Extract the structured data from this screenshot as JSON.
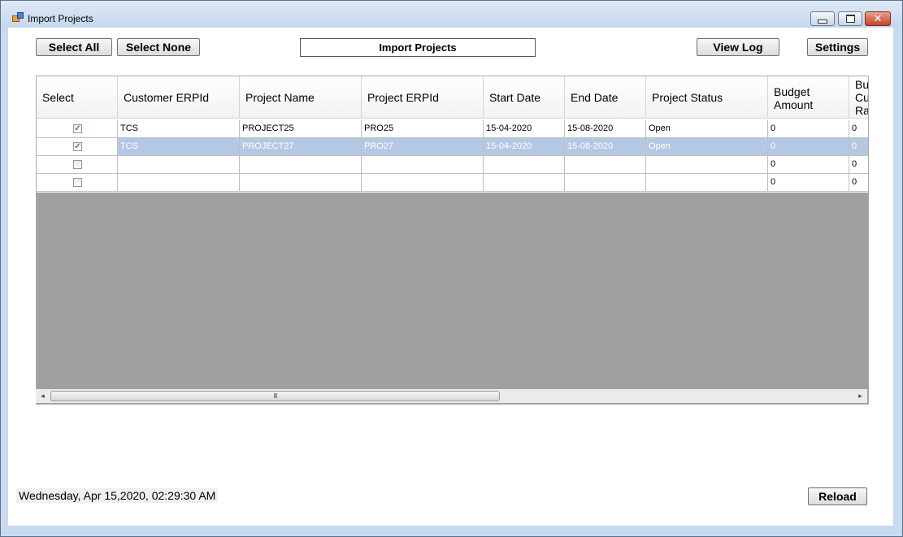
{
  "window": {
    "title": "Import Projects"
  },
  "toolbar": {
    "select_all": "Select All",
    "select_none": "Select None",
    "import_projects": "Import Projects",
    "view_log": "View Log",
    "settings": "Settings"
  },
  "grid": {
    "columns": [
      "Select",
      "Customer ERPId",
      "Project Name",
      "Project ERPId",
      "Start Date",
      "End Date",
      "Project Status",
      "Budget\nAmount",
      "Bu\nCu\nRa"
    ],
    "rows": [
      {
        "checked": true,
        "selected": false,
        "cells": [
          "TCS",
          "PROJECT25",
          "PRO25",
          "15-04-2020",
          "15-08-2020",
          "Open",
          "0",
          "0"
        ]
      },
      {
        "checked": true,
        "selected": true,
        "cells": [
          "TCS",
          "PROJECT27",
          "PRO27",
          "15-04-2020",
          "15-08-2020",
          "Open",
          "0",
          "0"
        ]
      },
      {
        "checked": false,
        "selected": false,
        "cells": [
          "",
          "",
          "",
          "",
          "",
          "",
          "0",
          "0"
        ]
      },
      {
        "checked": false,
        "selected": false,
        "cells": [
          "",
          "",
          "",
          "",
          "",
          "",
          "0",
          "0"
        ]
      }
    ]
  },
  "scrollbar": {
    "thumb_grip": "III"
  },
  "status": {
    "datetime": "Wednesday, Apr 15,2020, 02:29:30 AM"
  },
  "footer": {
    "reload": "Reload"
  },
  "icons": {
    "check": "✓",
    "left": "◂",
    "right": "▸",
    "close": "✕"
  }
}
